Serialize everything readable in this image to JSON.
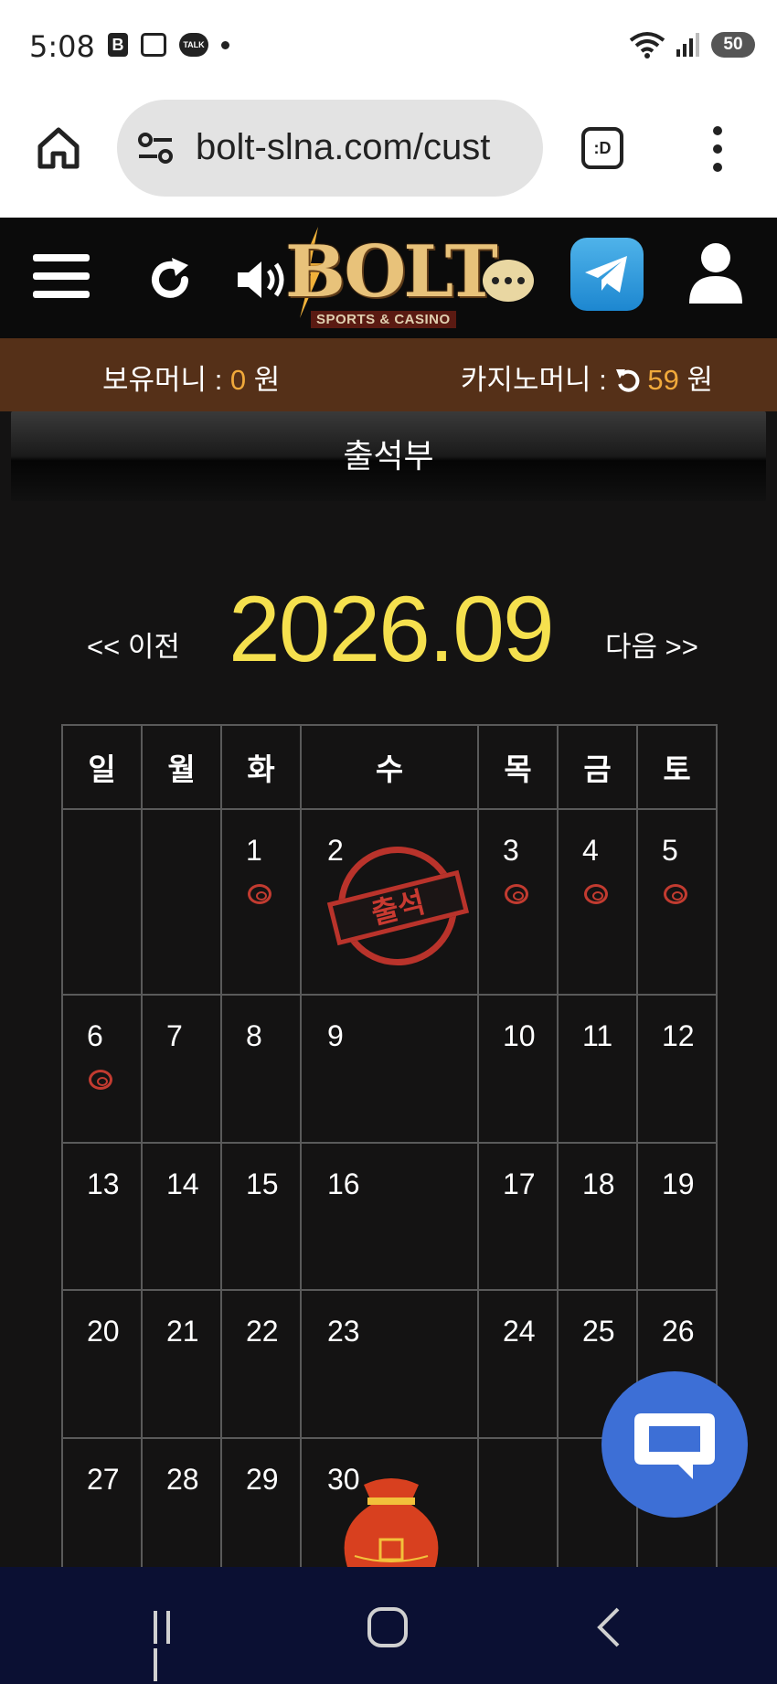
{
  "status_bar": {
    "time": "5:08",
    "b_icon": "B",
    "talk_icon": "TALK",
    "battery": "50"
  },
  "browser": {
    "url": "bolt-slna.com/cust",
    "tab_switcher": ":D"
  },
  "header": {
    "logo_text": "BOLT",
    "logo_sub": "SPORTS & CASINO"
  },
  "money": {
    "balance_label": "보유머니 : ",
    "balance_value": "0",
    "balance_unit": " 원",
    "casino_label": "카지노머니 : ",
    "casino_value": "59",
    "casino_unit": " 원"
  },
  "page": {
    "title": "출석부"
  },
  "calendar": {
    "prev_label": "<< 이전",
    "current_month": "2026.09",
    "next_label": "다음 >>",
    "weekdays": [
      "일",
      "월",
      "화",
      "수",
      "목",
      "금",
      "토"
    ],
    "stamp_label": "출석",
    "week1": [
      "",
      "",
      "1",
      "2",
      "3",
      "4",
      "5"
    ],
    "week2": [
      "6",
      "7",
      "8",
      "9",
      "10",
      "11",
      "12"
    ],
    "week3": [
      "13",
      "14",
      "15",
      "16",
      "17",
      "18",
      "19"
    ],
    "week4": [
      "20",
      "21",
      "22",
      "23",
      "24",
      "25",
      "26"
    ],
    "week5": [
      "27",
      "28",
      "29",
      "30",
      "",
      "",
      ""
    ],
    "attended_days": [
      "2"
    ],
    "coin_days": [
      "1",
      "3",
      "4",
      "5",
      "6"
    ]
  },
  "colors": {
    "accent_gold": "#f5e04e",
    "money_value": "#f0a93b",
    "stamp_red": "#b9332b",
    "chat_fab": "#3d6fd6"
  }
}
